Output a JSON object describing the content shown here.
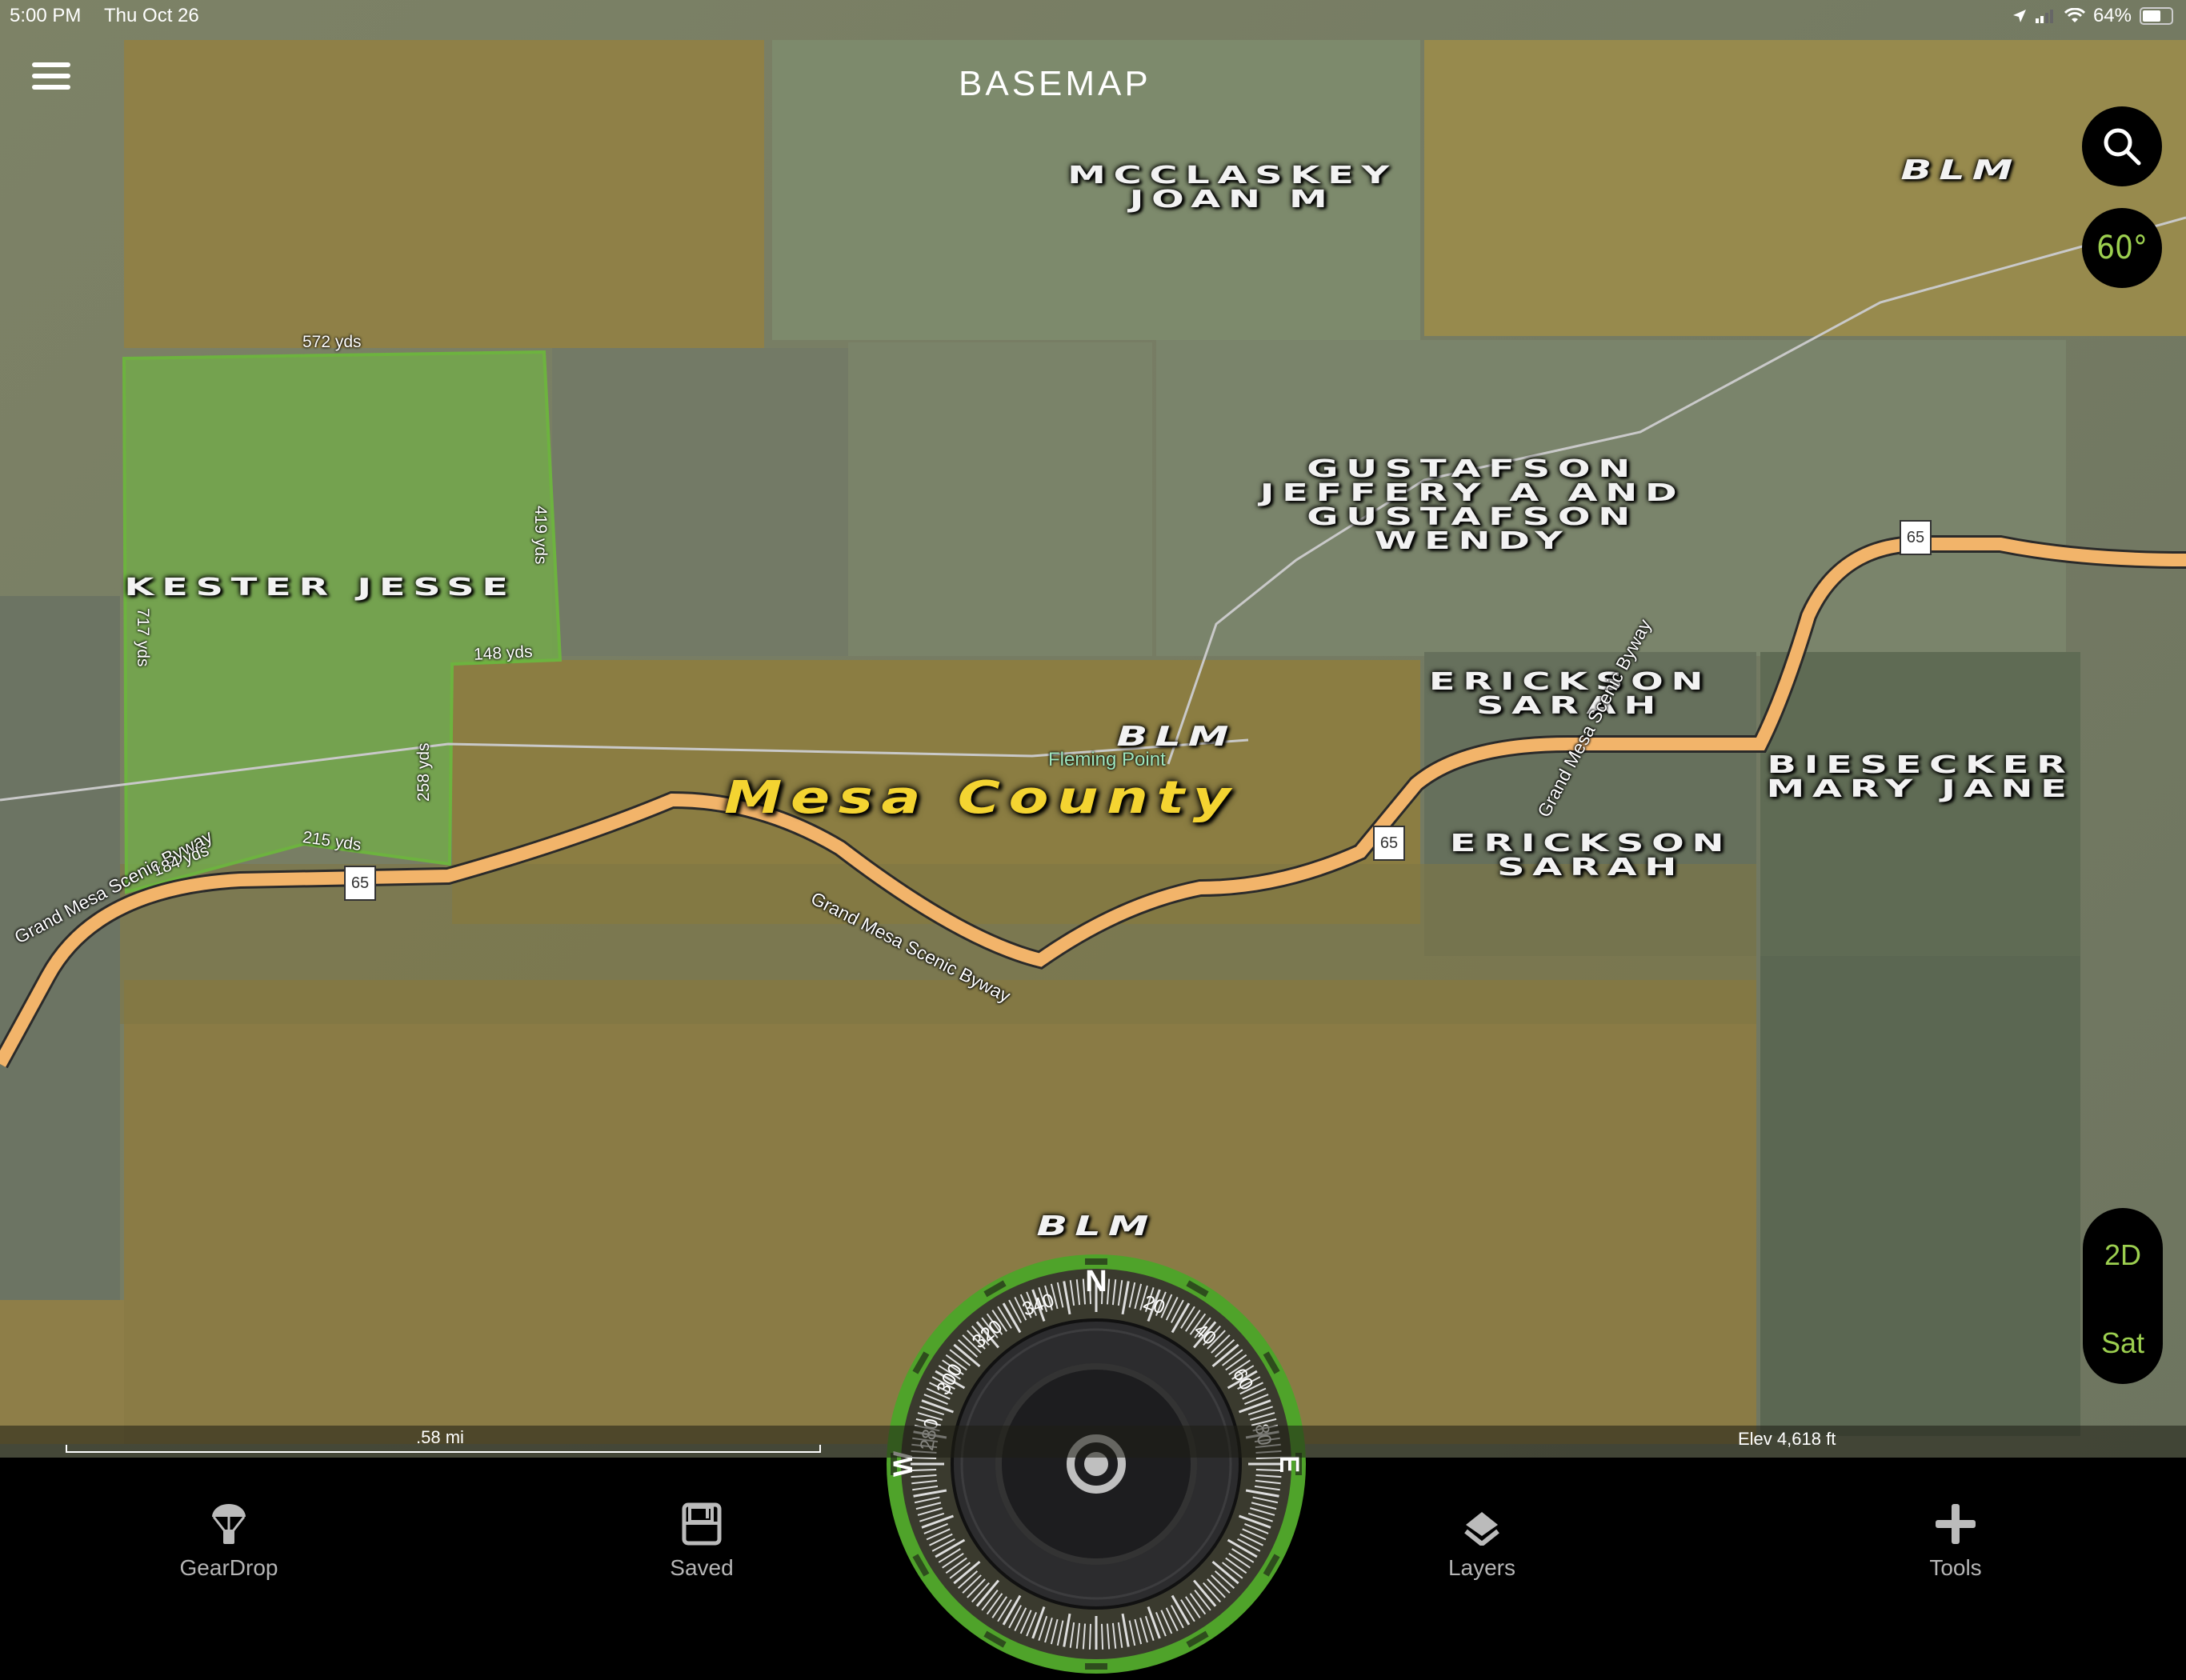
{
  "status_bar": {
    "time": "5:00 PM",
    "date": "Thu Oct 26",
    "battery_percent": "64%",
    "battery_level": 0.64,
    "icons": [
      "location-arrow-icon",
      "cellular-signal-icon",
      "wifi-icon",
      "battery-icon"
    ]
  },
  "header": {
    "logo": "BASEMAP",
    "menu_icon": "hamburger-menu-icon"
  },
  "map_controls": {
    "search_icon": "search-icon",
    "tilt_label": "60°",
    "view_mode": "2D",
    "map_type": "Sat"
  },
  "map": {
    "county_label": "Mesa County",
    "parcels": [
      {
        "owner_lines": [
          "MCCLASKEY",
          "JOAN M"
        ]
      },
      {
        "owner_lines": [
          "GUSTAFSON",
          "JEFFERY A AND",
          "GUSTAFSON",
          "WENDY"
        ]
      },
      {
        "owner_lines": [
          "KESTER JESSE"
        ]
      },
      {
        "owner_lines": [
          "ERICKSON",
          "SARAH"
        ]
      },
      {
        "owner_lines": [
          "ERICKSON",
          "SARAH"
        ]
      },
      {
        "owner_lines": [
          "BIESECKER",
          "MARY JANE"
        ]
      }
    ],
    "blm_labels": [
      "BLM",
      "BLM",
      "BLM"
    ],
    "poi": "Fleming Point",
    "road_name": "Grand Mesa Scenic Byway",
    "route_shield": "65",
    "dimensions": {
      "top": "572 yds",
      "right": "419 yds",
      "left": "717 yds",
      "notch": "148 yds",
      "notch_side": "258 yds",
      "bottom_left": "184 yds",
      "bottom_mid": "215 yds"
    }
  },
  "info_bar": {
    "scale": ".58 mi",
    "elevation": "Elev 4,618 ft"
  },
  "compass": {
    "heading_deg": 0,
    "north_label": "N",
    "west_label": "W",
    "east_label": "E",
    "tick_labels": [
      "280",
      "300",
      "320",
      "340",
      "20",
      "40",
      "60",
      "80"
    ],
    "center_icon": "locate-target-icon"
  },
  "tabs": [
    {
      "label": "GearDrop",
      "icon": "parachute-icon"
    },
    {
      "label": "Saved",
      "icon": "save-disk-icon"
    },
    {
      "label": "Layers",
      "icon": "layers-icon"
    },
    {
      "label": "Tools",
      "icon": "plus-icon"
    }
  ],
  "colors": {
    "accent_green": "#9ccf4f",
    "compass_green": "#4fa32a",
    "county_yellow": "#f4d431",
    "road_orange": "#f2b46a",
    "parcel_highlight": "#6db33f",
    "poi_green": "#9ee6be"
  }
}
